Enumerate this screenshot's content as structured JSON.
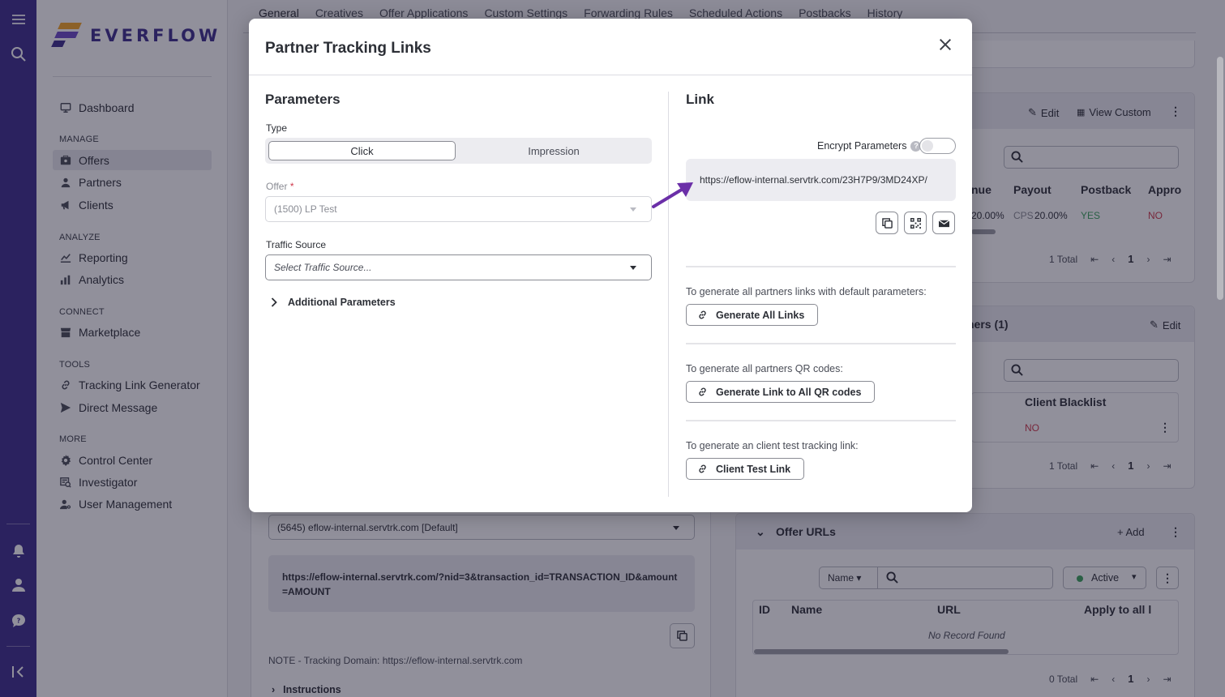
{
  "brand": {
    "name": "EVERFLOW"
  },
  "nav": {
    "dashboard": "Dashboard",
    "sections": {
      "manage": "MANAGE",
      "analyze": "ANALYZE",
      "connect": "CONNECT",
      "tools": "TOOLS",
      "more": "MORE"
    },
    "items": {
      "offers": "Offers",
      "partners": "Partners",
      "clients": "Clients",
      "reporting": "Reporting",
      "analytics": "Analytics",
      "marketplace": "Marketplace",
      "tracking_link_generator": "Tracking Link Generator",
      "direct_message": "Direct Message",
      "control_center": "Control Center",
      "investigator": "Investigator",
      "user_management": "User Management"
    }
  },
  "background": {
    "tabs": [
      "General",
      "Creatives",
      "Offer Applications",
      "Custom Settings",
      "Forwarding Rules",
      "Scheduled Actions",
      "Postbacks",
      "History"
    ],
    "payout_card": {
      "edit": "Edit",
      "view_custom": "View Custom",
      "cols": [
        "nue",
        "Payout",
        "Postback",
        "Appro"
      ],
      "row": {
        "revenue": "20.00%",
        "payout_type": "CPS",
        "payout": "20.00%",
        "postback": "YES",
        "approval": "NO"
      },
      "total": "1 Total",
      "page": "1"
    },
    "partners_card": {
      "title": "ners (1)",
      "edit": "Edit",
      "col": "Client Blacklist",
      "value": "NO",
      "total": "1 Total",
      "page": "1"
    },
    "offer_urls_card": {
      "title": "Offer URLs",
      "add": "Add",
      "filter_name": "Name",
      "status": "Active",
      "cols": [
        "ID",
        "Name",
        "URL",
        "Apply to all l"
      ],
      "empty": "No Record Found",
      "total": "0 Total",
      "page": "1"
    },
    "tracking": {
      "domain_select": "(5645) eflow-internal.servtrk.com [Default]",
      "postback_url": "https://eflow-internal.servtrk.com/?nid=3&transaction_id=TRANSACTION_ID&amount=AMOUNT",
      "note": "NOTE - Tracking Domain: https://eflow-internal.servtrk.com",
      "instructions": "Instructions"
    }
  },
  "modal": {
    "title": "Partner Tracking Links",
    "parameters": {
      "title": "Parameters",
      "type_label": "Type",
      "type_options": [
        "Click",
        "Impression"
      ],
      "type_selected": "Click",
      "offer_label": "Offer",
      "offer_required_mark": "*",
      "offer_value": "(1500) LP Test",
      "traffic_source_label": "Traffic Source",
      "traffic_source_placeholder": "Select Traffic Source...",
      "additional_parameters": "Additional Parameters"
    },
    "link": {
      "title": "Link",
      "encrypt_label": "Encrypt Parameters",
      "encrypt_on": false,
      "url": "https://eflow-internal.servtrk.com/23H7P9/3MD24XP/",
      "generate_all_text": "To generate all partners links with default parameters:",
      "generate_all_button": "Generate All Links",
      "qr_text": "To generate all partners QR codes:",
      "qr_button": "Generate Link to All QR codes",
      "client_test_text": "To generate an client test tracking link:",
      "client_test_button": "Client Test Link"
    }
  },
  "colors": {
    "rail": "#3d2c8d",
    "accent_orange": "#f5a623",
    "accent_purple": "#6b49c8",
    "arrow": "#6b2fa8"
  }
}
